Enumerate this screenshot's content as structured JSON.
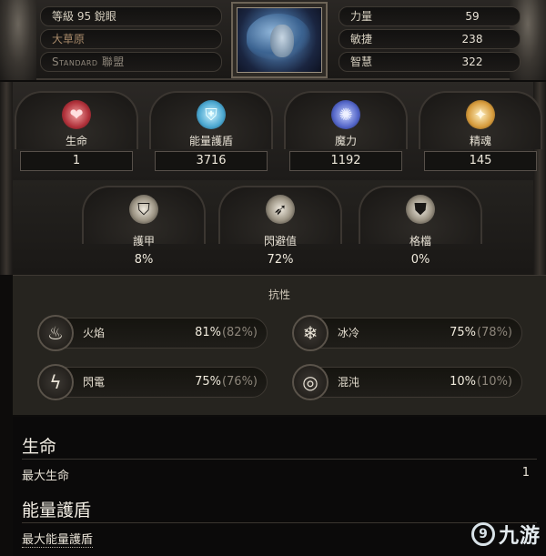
{
  "header": {
    "level_row": "等級 95 銳眼",
    "area_row": "大草原",
    "league_row": "Standard 聯盟",
    "attributes": [
      {
        "label": "力量",
        "value": "59"
      },
      {
        "label": "敏捷",
        "value": "238"
      },
      {
        "label": "智慧",
        "value": "322"
      }
    ]
  },
  "stats_top": [
    {
      "label": "生命",
      "value": "1",
      "icon": "heart-icon"
    },
    {
      "label": "能量護盾",
      "value": "3716",
      "icon": "energy-shield-icon"
    },
    {
      "label": "魔力",
      "value": "1192",
      "icon": "mana-icon"
    },
    {
      "label": "精魂",
      "value": "145",
      "icon": "spirit-icon"
    }
  ],
  "stats_def": [
    {
      "label": "護甲",
      "value": "8%",
      "icon": "armour-icon"
    },
    {
      "label": "閃避值",
      "value": "72%",
      "icon": "evasion-icon"
    },
    {
      "label": "格檔",
      "value": "0%",
      "icon": "block-shield-icon"
    }
  ],
  "resist": {
    "title": "抗性",
    "items": [
      {
        "label": "火焰",
        "value": "81%",
        "max": "(82%)",
        "icon": "fire-icon"
      },
      {
        "label": "冰冷",
        "value": "75%",
        "max": "(78%)",
        "icon": "cold-icon"
      },
      {
        "label": "閃電",
        "value": "75%",
        "max": "(76%)",
        "icon": "lightning-icon"
      },
      {
        "label": "混沌",
        "value": "10%",
        "max": "(10%)",
        "icon": "chaos-icon"
      }
    ]
  },
  "details": {
    "life_title": "生命",
    "max_life_label": "最大生命",
    "max_life_value": "1",
    "es_title": "能量護盾",
    "max_es_label": "最大能量護盾"
  },
  "watermark": {
    "logo": "9",
    "text": "九游"
  }
}
